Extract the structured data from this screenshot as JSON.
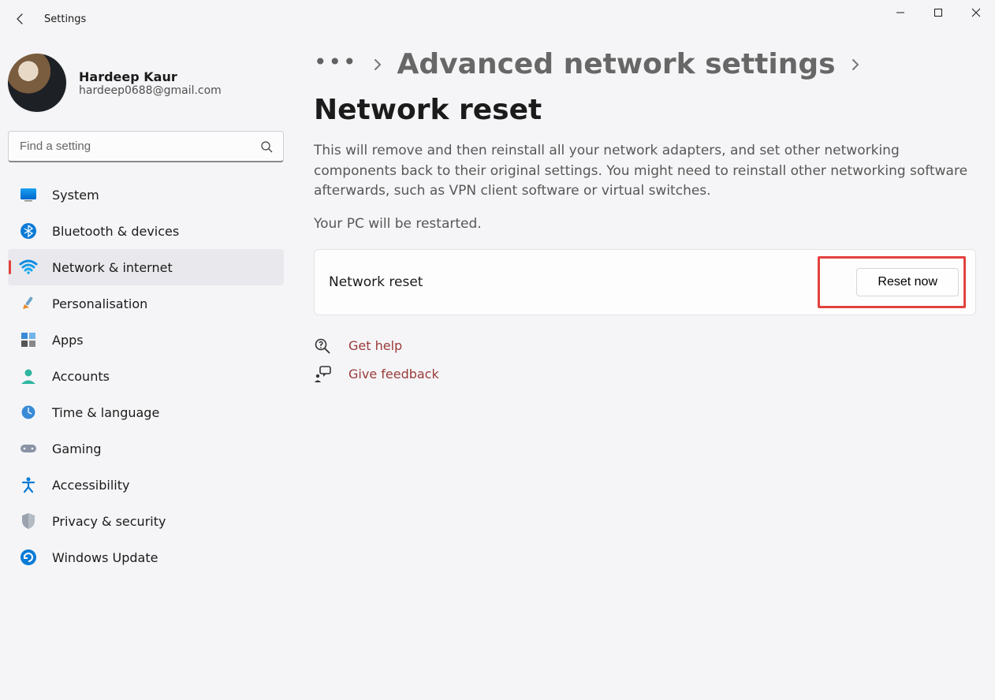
{
  "app": {
    "title": "Settings"
  },
  "profile": {
    "name": "Hardeep Kaur",
    "email": "hardeep0688@gmail.com"
  },
  "search": {
    "placeholder": "Find a setting"
  },
  "sidebar": {
    "items": [
      {
        "label": "System"
      },
      {
        "label": "Bluetooth & devices"
      },
      {
        "label": "Network & internet"
      },
      {
        "label": "Personalisation"
      },
      {
        "label": "Apps"
      },
      {
        "label": "Accounts"
      },
      {
        "label": "Time & language"
      },
      {
        "label": "Gaming"
      },
      {
        "label": "Accessibility"
      },
      {
        "label": "Privacy & security"
      },
      {
        "label": "Windows Update"
      }
    ]
  },
  "breadcrumb": {
    "parent": "Advanced network settings",
    "current": "Network reset"
  },
  "content": {
    "description": "This will remove and then reinstall all your network adapters, and set other networking components back to their original settings. You might need to reinstall other networking software afterwards, such as VPN client software or virtual switches.",
    "restart_note": "Your PC will be restarted.",
    "card_label": "Network reset",
    "reset_button": "Reset now",
    "help": "Get help",
    "feedback": "Give feedback"
  }
}
